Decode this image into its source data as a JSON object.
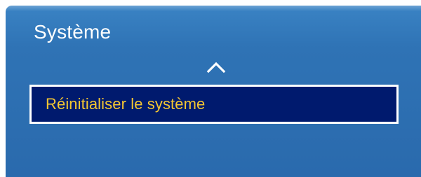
{
  "menu": {
    "title": "Système",
    "items": [
      {
        "label": "Réinitialiser le système",
        "selected": true
      }
    ]
  },
  "icons": {
    "scroll_up": "chevron-up-icon"
  },
  "colors": {
    "panel_background": "#2f73b5",
    "selection_background": "#001a6e",
    "selection_border": "#ffffff",
    "selected_text": "#f3c632",
    "title_text": "#ffffff"
  }
}
